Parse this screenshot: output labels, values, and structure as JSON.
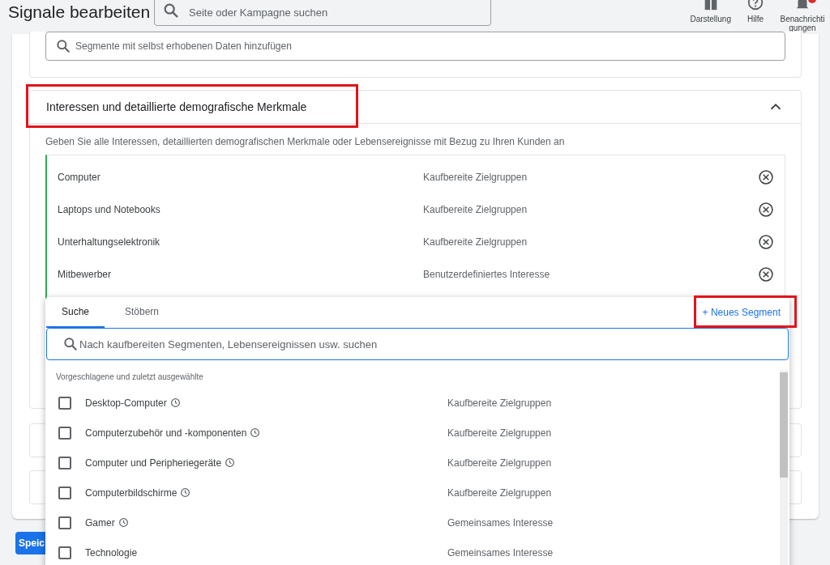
{
  "header": {
    "title": "Signale bearbeiten",
    "search": {
      "placeholder": "Seite oder Kampagne suchen"
    },
    "actions": [
      {
        "kind": "display",
        "label": "Darstellung",
        "badge": false
      },
      {
        "kind": "help",
        "label": "Hilfe",
        "badge": false
      },
      {
        "kind": "bell",
        "label": "Benachrichtigungen",
        "badge": true
      }
    ]
  },
  "data_segments": {
    "search": {
      "placeholder": "Segmente mit selbst erhobenen Daten hinzufügen"
    }
  },
  "interests": {
    "title": "Interessen und detaillierte demografische Merkmale",
    "expanded": true,
    "description": "Geben Sie alle Interessen, detaillierten demografischen Merkmale oder Lebensereignisse mit Bezug zu Ihren Kunden an",
    "selected_segments": [
      {
        "name": "Computer",
        "category": "Kaufbereite Zielgruppen"
      },
      {
        "name": "Laptops und Notebooks",
        "category": "Kaufbereite Zielgruppen"
      },
      {
        "name": "Unterhaltungselektronik",
        "category": "Kaufbereite Zielgruppen"
      },
      {
        "name": "Mitbewerber",
        "category": "Benutzerdefiniertes Interesse"
      }
    ]
  },
  "picker": {
    "tabs": [
      {
        "label": "Suche",
        "selected": true
      },
      {
        "label": "Stöbern",
        "selected": false
      }
    ],
    "new_segment_link": "+ Neues Segment",
    "search": {
      "placeholder": "Nach kaufbereiten Segmenten, Lebensereignissen usw. suchen"
    },
    "list_heading": "Vorgeschlagene und zuletzt ausgewählte",
    "suggestions": [
      {
        "name": "Desktop-Computer",
        "category": "Kaufbereite Zielgruppen",
        "checked": false,
        "recent": true
      },
      {
        "name": "Computerzubehör und -komponenten",
        "category": "Kaufbereite Zielgruppen",
        "checked": false,
        "recent": true
      },
      {
        "name": "Computer und Peripheriegeräte",
        "category": "Kaufbereite Zielgruppen",
        "checked": false,
        "recent": true
      },
      {
        "name": "Computerbildschirme",
        "category": "Kaufbereite Zielgruppen",
        "checked": false,
        "recent": true
      },
      {
        "name": "Gamer",
        "category": "Gemeinsames Interesse",
        "checked": false,
        "recent": true
      },
      {
        "name": "Technologie",
        "category": "Gemeinsames Interesse",
        "checked": false,
        "recent": false
      }
    ]
  },
  "save_button": "Speic"
}
